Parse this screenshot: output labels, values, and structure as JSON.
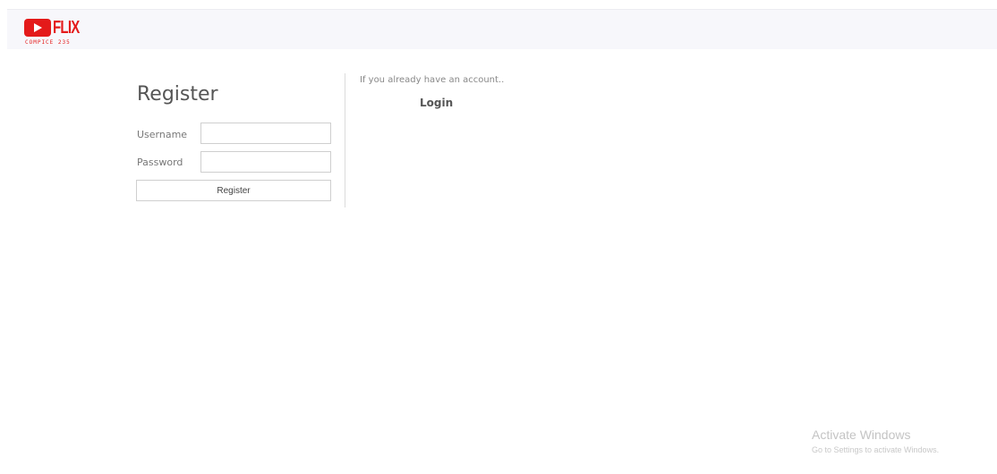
{
  "header": {
    "logo": {
      "icon": "play-button-icon",
      "word": "FLIX",
      "subtitle": "COMPICE 235",
      "color": "#e41a1a"
    }
  },
  "register": {
    "title": "Register",
    "username_label": "Username",
    "username_value": "",
    "password_label": "Password",
    "password_value": "",
    "submit_label": "Register"
  },
  "login": {
    "note": "If you already have an account..",
    "link_label": "Login"
  },
  "watermark": {
    "title": "Activate Windows",
    "subtitle": "Go to Settings to activate Windows."
  }
}
